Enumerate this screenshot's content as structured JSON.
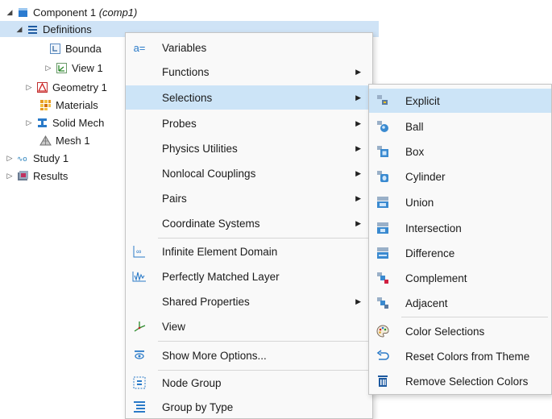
{
  "tree": {
    "items": [
      {
        "label": "Component 1",
        "suffix": "(comp1)",
        "icon": "component-icon",
        "toggle": "◢"
      },
      {
        "label": "Definitions",
        "icon": "definitions-icon",
        "toggle": "◢"
      },
      {
        "label": "Bounda",
        "icon": "boundary-icon"
      },
      {
        "label": "View 1",
        "icon": "view-icon",
        "toggle": "▷"
      },
      {
        "label": "Geometry 1",
        "icon": "geometry-icon",
        "toggle": "▷"
      },
      {
        "label": "Materials",
        "icon": "materials-icon"
      },
      {
        "label": "Solid Mech",
        "icon": "solid-mechanics-icon",
        "toggle": "▷"
      },
      {
        "label": "Mesh 1",
        "icon": "mesh-icon"
      },
      {
        "label": "Study 1",
        "icon": "study-icon",
        "toggle": "▷"
      },
      {
        "label": "Results",
        "icon": "results-icon",
        "toggle": "▷"
      }
    ]
  },
  "context_menu": {
    "items": [
      {
        "label": "Variables",
        "icon": "variables-icon"
      },
      {
        "label": "Functions",
        "submenu": true
      },
      {
        "label": "Selections",
        "submenu": true,
        "highlighted": true
      },
      {
        "label": "Probes",
        "submenu": true
      },
      {
        "label": "Physics Utilities",
        "submenu": true
      },
      {
        "label": "Nonlocal Couplings",
        "submenu": true
      },
      {
        "label": "Pairs",
        "submenu": true
      },
      {
        "label": "Coordinate Systems",
        "submenu": true
      },
      {
        "label": "Infinite Element Domain",
        "icon": "infinite-element-icon"
      },
      {
        "label": "Perfectly Matched Layer",
        "icon": "pml-icon"
      },
      {
        "label": "Shared Properties",
        "submenu": true
      },
      {
        "label": "View",
        "icon": "view-icon"
      },
      {
        "label": "Show More Options...",
        "icon": "show-more-icon"
      },
      {
        "label": "Node Group",
        "icon": "node-group-icon"
      },
      {
        "label": "Group by Type",
        "icon": "group-by-type-icon"
      }
    ],
    "arrow_glyph": "▶"
  },
  "selections_submenu": {
    "items": [
      {
        "label": "Explicit",
        "icon": "explicit-selection-icon",
        "highlighted": true
      },
      {
        "label": "Ball",
        "icon": "ball-selection-icon"
      },
      {
        "label": "Box",
        "icon": "box-selection-icon"
      },
      {
        "label": "Cylinder",
        "icon": "cylinder-selection-icon"
      },
      {
        "label": "Union",
        "icon": "union-selection-icon"
      },
      {
        "label": "Intersection",
        "icon": "intersection-selection-icon"
      },
      {
        "label": "Difference",
        "icon": "difference-selection-icon"
      },
      {
        "label": "Complement",
        "icon": "complement-selection-icon"
      },
      {
        "label": "Adjacent",
        "icon": "adjacent-selection-icon"
      },
      {
        "label": "Color Selections",
        "icon": "palette-icon"
      },
      {
        "label": "Reset Colors from Theme",
        "icon": "reset-icon"
      },
      {
        "label": "Remove Selection Colors",
        "icon": "trash-icon"
      }
    ]
  },
  "colors": {
    "highlight": "#cce4f7",
    "tree_selected": "#cfe3f6",
    "icon_blue": "#1e6fb8",
    "menu_bg": "#f9f9f9"
  }
}
